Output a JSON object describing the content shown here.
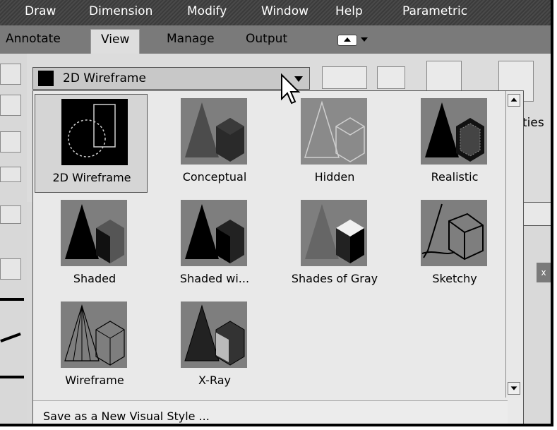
{
  "menubar": {
    "items": [
      "Draw",
      "Dimension",
      "Modify",
      "Window",
      "Help",
      "Parametric"
    ]
  },
  "tabs": {
    "items": [
      "Annotate",
      "View",
      "Manage",
      "Output"
    ],
    "active": "View"
  },
  "visual_style_combo": {
    "current": "2D Wireframe"
  },
  "ribbon": {
    "partial_label": "ties"
  },
  "gallery": {
    "styles": [
      "2D Wireframe",
      "Conceptual",
      "Hidden",
      "Realistic",
      "Shaded",
      "Shaded wi...",
      "Shades of Gray",
      "Sketchy",
      "Wireframe",
      "X-Ray"
    ],
    "selected": "2D Wireframe",
    "save_label": "Save as a New Visual Style ..."
  },
  "panel": {
    "close_label": "x"
  },
  "icons": [
    "scroll-up-icon",
    "scroll-down-icon",
    "dropdown-arrow-icon",
    "mouse-pointer-icon",
    "workspace-switch-icon"
  ]
}
